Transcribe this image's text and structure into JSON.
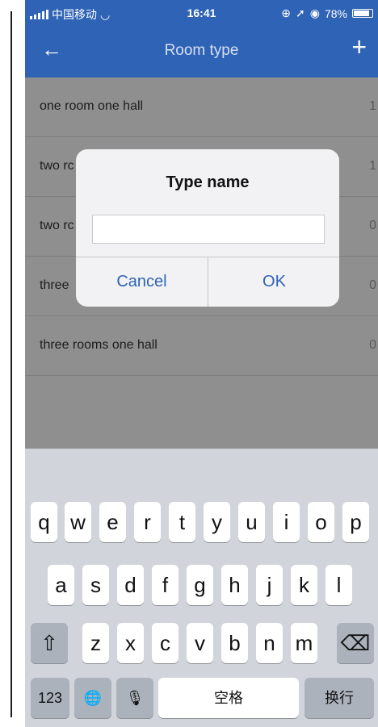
{
  "status": {
    "carrier": "中国移动",
    "time": "16:41",
    "battery": "78%"
  },
  "nav": {
    "back_icon": "←",
    "title": "Room type",
    "add_icon": "+"
  },
  "list": {
    "items": [
      {
        "label": "one room one hall",
        "count": "1"
      },
      {
        "label": "two rc",
        "count": "1"
      },
      {
        "label": "two rc",
        "count": "0"
      },
      {
        "label": "three",
        "count": "0"
      },
      {
        "label": "three rooms one hall",
        "count": "0"
      }
    ]
  },
  "dialog": {
    "title": "Type name",
    "input_value": "",
    "cancel_label": "Cancel",
    "ok_label": "OK"
  },
  "keyboard": {
    "row1": [
      "q",
      "w",
      "e",
      "r",
      "t",
      "y",
      "u",
      "i",
      "o",
      "p"
    ],
    "row2": [
      "a",
      "s",
      "d",
      "f",
      "g",
      "h",
      "j",
      "k",
      "l"
    ],
    "row3": [
      "z",
      "x",
      "c",
      "v",
      "b",
      "n",
      "m"
    ],
    "shift_icon": "⇧",
    "delete_icon": "⌫",
    "numbers_label": "123",
    "globe_icon": "🌐",
    "mic_icon": "🎙",
    "space_label": "空格",
    "return_label": "换行"
  },
  "colors": {
    "nav_bg": "#2f63b6",
    "accent": "#2f63b6",
    "keyboard_bg": "#d1d4da"
  }
}
